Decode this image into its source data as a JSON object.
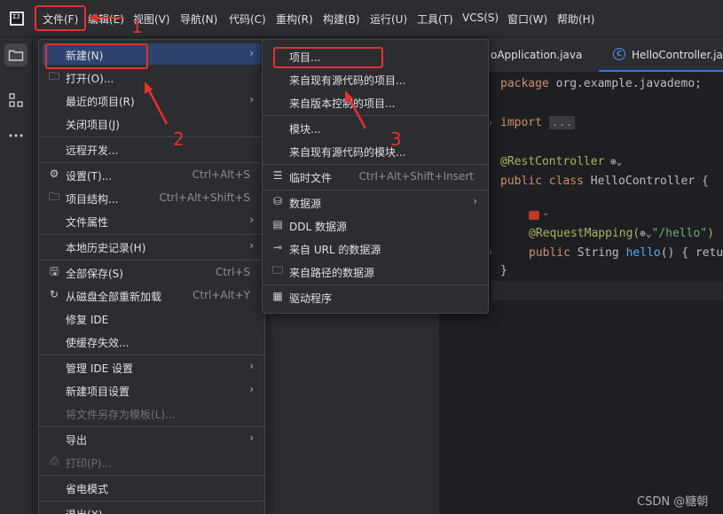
{
  "menubar": {
    "logo": "IJ",
    "items": [
      "文件(F)",
      "编辑(E)",
      "视图(V)",
      "导航(N)",
      "代码(C)",
      "重构(R)",
      "构建(B)",
      "运行(U)",
      "工具(T)",
      "VCS(S)",
      "窗口(W)",
      "帮助(H)"
    ]
  },
  "tabs": [
    "oApplication.java",
    "HelloController.jav"
  ],
  "code": {
    "line1_kw": "package",
    "line1_rest": " org.example.javademo;",
    "line2_kw": "import",
    "line2_fold": "...",
    "line3": "@RestController",
    "line4_kw": "public class",
    "line4_rest": " HelloController {",
    "line5_ann": "@RequestMapping(",
    "line5_str": "\"/hello\"",
    "line5_end": ")",
    "line6_kw": "public",
    "line6_type": " String ",
    "line6_fn": "hello",
    "line6_rest": "() { retu",
    "line7": "}"
  },
  "file_menu": {
    "items": [
      {
        "label": "新建(N)",
        "shortcut": "",
        "arrow": true
      },
      {
        "label": "打开(O)...",
        "shortcut": "",
        "arrow": false
      },
      {
        "label": "最近的项目(R)",
        "shortcut": "",
        "arrow": true
      },
      {
        "label": "关闭项目(J)",
        "shortcut": "",
        "arrow": false
      },
      {
        "label": "远程开发...",
        "shortcut": "",
        "arrow": false
      },
      {
        "label": "设置(T)...",
        "shortcut": "Ctrl+Alt+S",
        "arrow": false
      },
      {
        "label": "项目结构...",
        "shortcut": "Ctrl+Alt+Shift+S",
        "arrow": false
      },
      {
        "label": "文件属性",
        "shortcut": "",
        "arrow": true
      },
      {
        "label": "本地历史记录(H)",
        "shortcut": "",
        "arrow": true
      },
      {
        "label": "全部保存(S)",
        "shortcut": "Ctrl+S",
        "arrow": false
      },
      {
        "label": "从磁盘全部重新加载",
        "shortcut": "Ctrl+Alt+Y",
        "arrow": false
      },
      {
        "label": "修复 IDE",
        "shortcut": "",
        "arrow": false
      },
      {
        "label": "使缓存失效...",
        "shortcut": "",
        "arrow": false
      },
      {
        "label": "管理 IDE 设置",
        "shortcut": "",
        "arrow": true
      },
      {
        "label": "新建项目设置",
        "shortcut": "",
        "arrow": true
      },
      {
        "label": "将文件另存为模板(L)...",
        "shortcut": "",
        "arrow": false
      },
      {
        "label": "导出",
        "shortcut": "",
        "arrow": true
      },
      {
        "label": "打印(P)...",
        "shortcut": "",
        "arrow": false
      },
      {
        "label": "省电模式",
        "shortcut": "",
        "arrow": false
      },
      {
        "label": "退出(X)",
        "shortcut": "",
        "arrow": false
      }
    ]
  },
  "new_menu": {
    "items": [
      {
        "label": "项目...",
        "shortcut": ""
      },
      {
        "label": "来自现有源代码的项目...",
        "shortcut": ""
      },
      {
        "label": "来自版本控制的项目...",
        "shortcut": ""
      },
      {
        "label": "模块...",
        "shortcut": ""
      },
      {
        "label": "来自现有源代码的模块...",
        "shortcut": ""
      },
      {
        "label": "临时文件",
        "shortcut": "Ctrl+Alt+Shift+Insert"
      },
      {
        "label": "数据源",
        "shortcut": ""
      },
      {
        "label": "DDL 数据源",
        "shortcut": ""
      },
      {
        "label": "来自 URL 的数据源",
        "shortcut": ""
      },
      {
        "label": "来自路径的数据源",
        "shortcut": ""
      },
      {
        "label": "驱动程序",
        "shortcut": ""
      }
    ]
  },
  "annotations": [
    "1",
    "2",
    "3"
  ],
  "watermark": "CSDN @糖朝",
  "colors": {
    "accent": "#3574f0",
    "highlight": "#2e436e",
    "annotation": "#e5322d"
  }
}
